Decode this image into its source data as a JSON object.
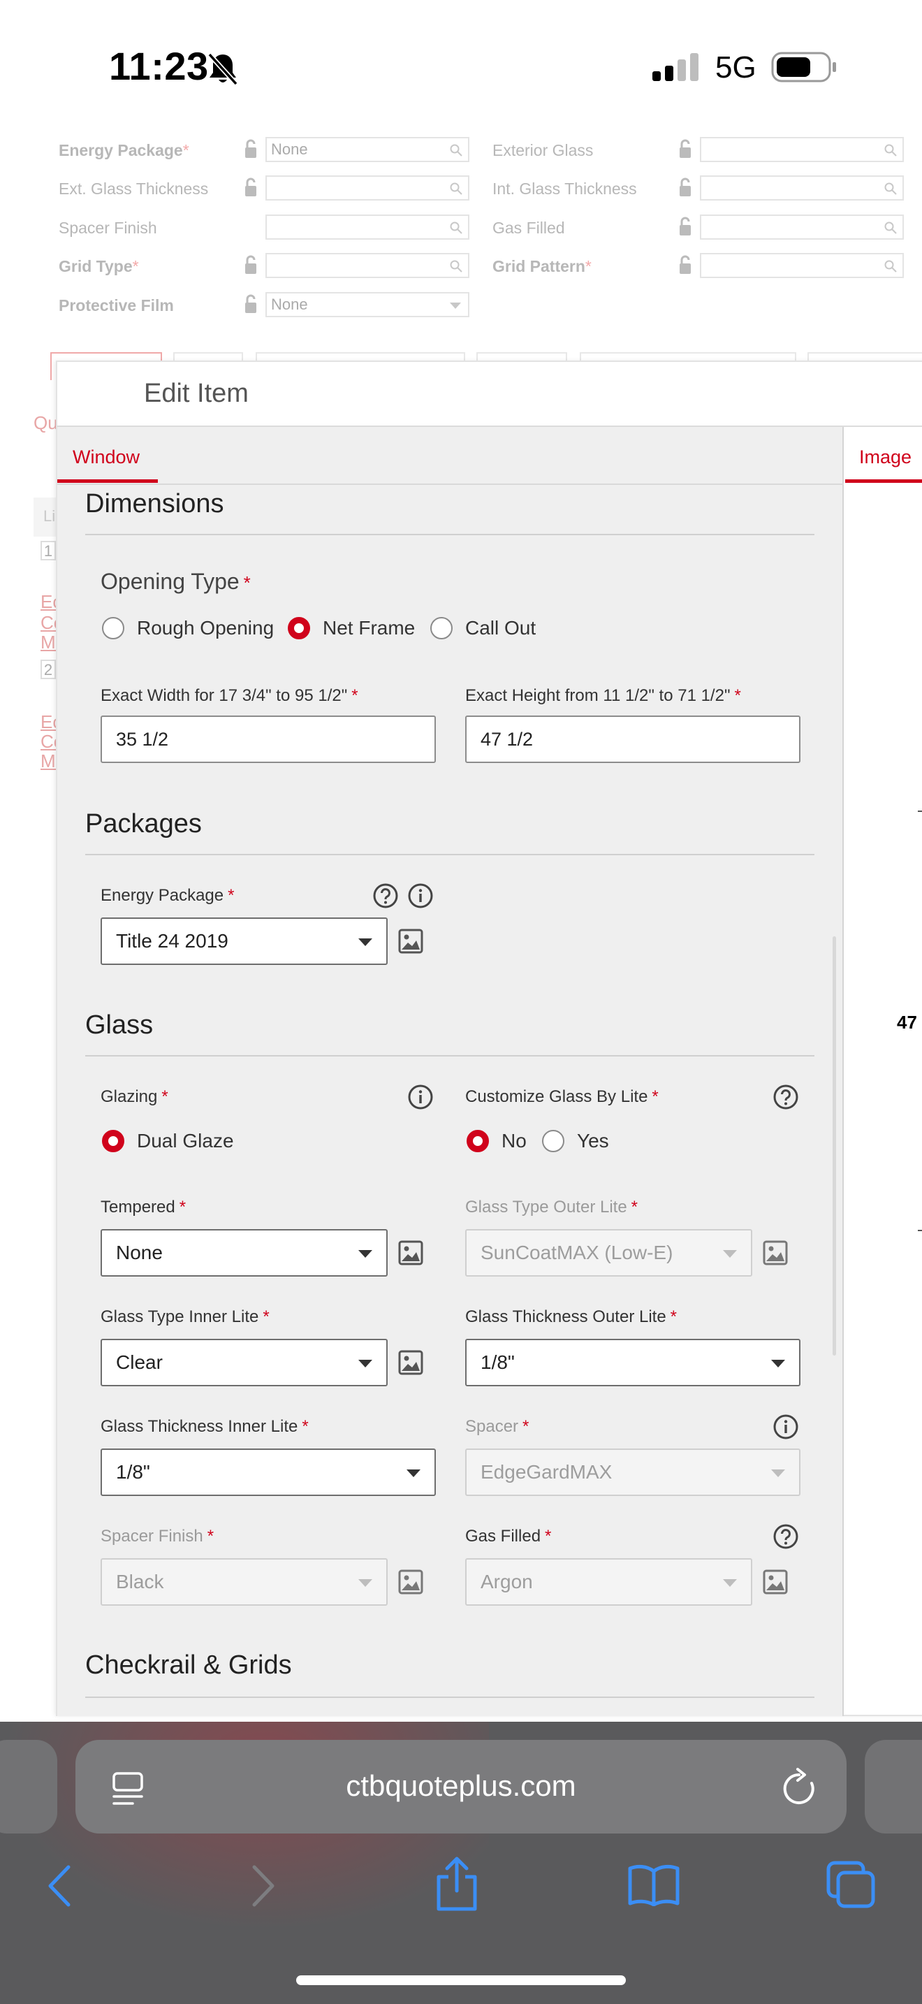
{
  "status_bar": {
    "time": "11:23",
    "network": "5G"
  },
  "background_form": {
    "rows": [
      {
        "left_label": "Energy Package",
        "left_required": true,
        "left_value": "None",
        "right_label": "Exterior Glass",
        "right_required": false,
        "right_value": ""
      },
      {
        "left_label": "Ext. Glass Thickness",
        "left_required": false,
        "left_value": "",
        "right_label": "Int. Glass Thickness",
        "right_required": false,
        "right_value": ""
      },
      {
        "left_label": "Spacer Finish",
        "left_required": false,
        "left_value": "",
        "right_label": "Gas Filled",
        "right_required": false,
        "right_value": ""
      },
      {
        "left_label": "Grid Type",
        "left_required": true,
        "left_value": "",
        "right_label": "Grid Pattern",
        "right_required": true,
        "right_value": ""
      },
      {
        "left_label": "Protective Film",
        "left_required": false,
        "left_value": "None"
      }
    ],
    "left_fragments": [
      "Qu",
      "Li",
      "1",
      "Ec",
      "Co",
      "Mc",
      "2",
      "Ec",
      "Co",
      "Mc"
    ]
  },
  "modal": {
    "title": "Edit Item",
    "tabs": {
      "window": "Window",
      "image": "Image"
    },
    "image_dimension": "47",
    "dimensions": {
      "title": "Dimensions",
      "opening_type_label": "Opening Type",
      "opening_options": [
        "Rough Opening",
        "Net Frame",
        "Call Out"
      ],
      "selected_opening": "Net Frame",
      "width_label": "Exact Width for 17 3/4\" to 95 1/2\"",
      "width_value": "35 1/2",
      "height_label": "Exact Height from 11 1/2\" to 71 1/2\"",
      "height_value": "47 1/2"
    },
    "packages": {
      "title": "Packages",
      "energy_label": "Energy Package",
      "energy_value": "Title 24 2019"
    },
    "glass": {
      "title": "Glass",
      "glazing_label": "Glazing",
      "glazing_option": "Dual Glaze",
      "customize_label": "Customize Glass By Lite",
      "customize_options": [
        "No",
        "Yes"
      ],
      "customize_selected": "No",
      "tempered_label": "Tempered",
      "tempered_value": "None",
      "outer_type_label": "Glass Type Outer Lite",
      "outer_type_value": "SunCoatMAX (Low-E)",
      "inner_type_label": "Glass Type Inner Lite",
      "inner_type_value": "Clear",
      "outer_thick_label": "Glass Thickness Outer Lite",
      "outer_thick_value": "1/8\"",
      "inner_thick_label": "Glass Thickness Inner Lite",
      "inner_thick_value": "1/8\"",
      "spacer_label": "Spacer",
      "spacer_value": "EdgeGardMAX",
      "spacer_finish_label": "Spacer Finish",
      "spacer_finish_value": "Black",
      "gas_label": "Gas Filled",
      "gas_value": "Argon"
    },
    "checkrail": {
      "title": "Checkrail & Grids"
    }
  },
  "browser": {
    "url": "ctbquoteplus.com"
  },
  "colors": {
    "accent": "#d0021b",
    "ios_blue": "#3b82f6",
    "chrome": "#5a5a5c"
  }
}
